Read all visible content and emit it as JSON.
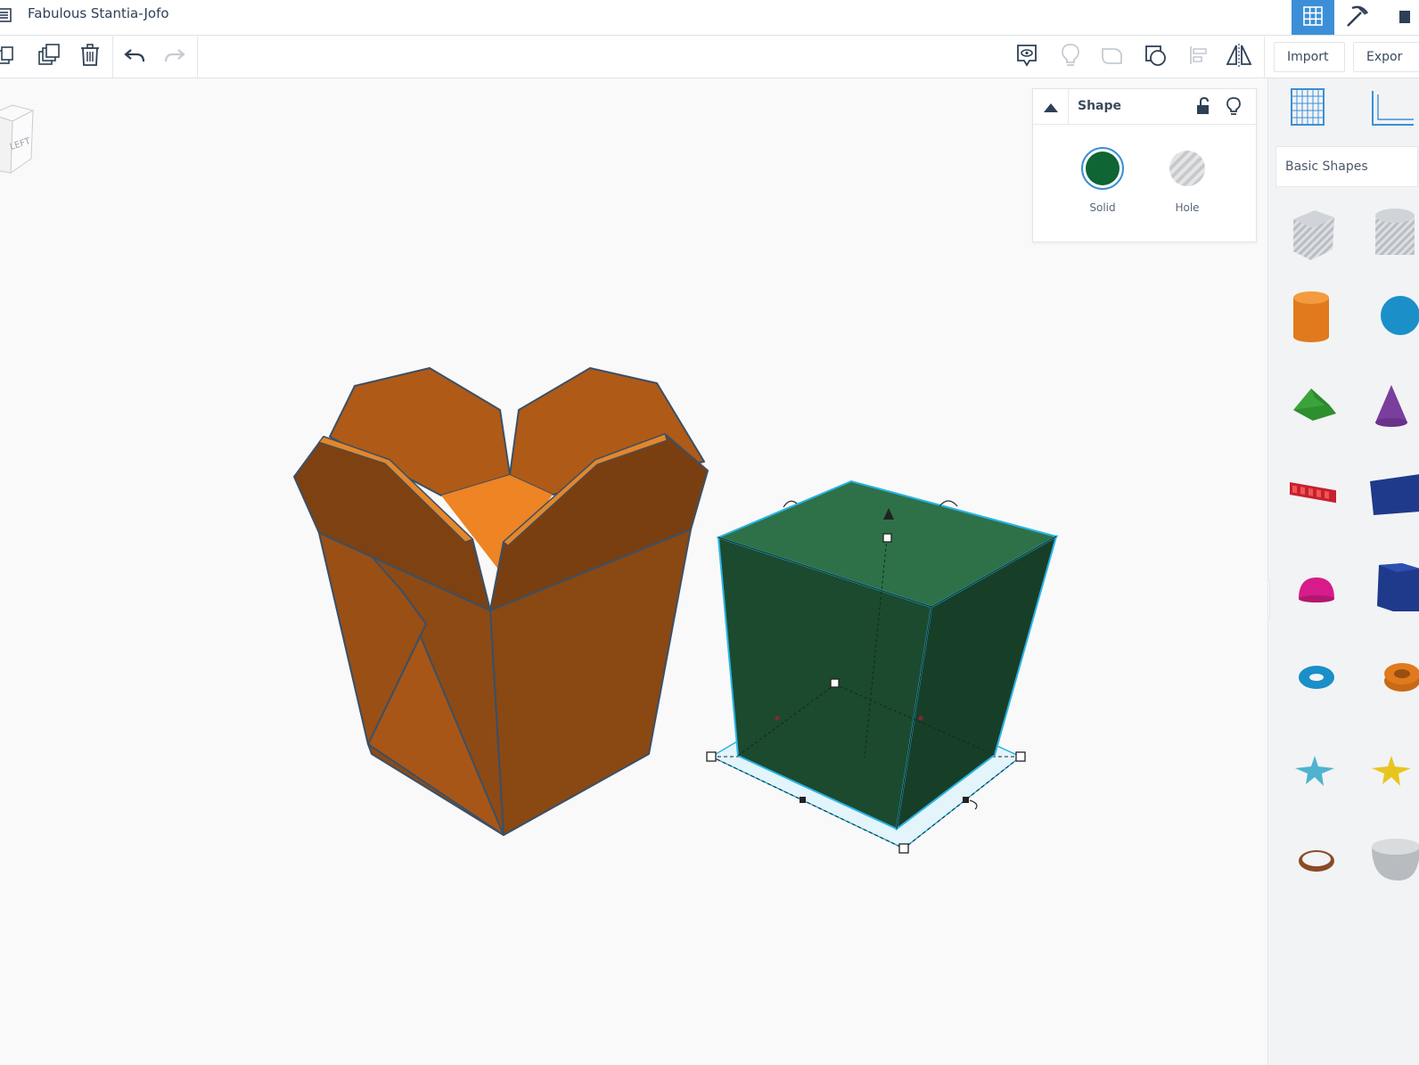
{
  "window": {
    "title": "Fabulous Stantia-Jofo"
  },
  "toolbar": {
    "import_label": "Import",
    "export_label": "Expor"
  },
  "viewcube": {
    "face_label": "LEFT"
  },
  "shape_panel": {
    "title": "Shape",
    "solid_label": "Solid",
    "hole_label": "Hole",
    "solid_color": "#0f6534",
    "selected": "Solid"
  },
  "sidebar": {
    "category": "Basic Shapes",
    "shapes": [
      "box-hole",
      "cylinder-hole",
      "cylinder",
      "sphere",
      "roof",
      "cone",
      "text",
      "wedge",
      "half-sphere",
      "polygon",
      "torus",
      "tube",
      "star",
      "star-yellow",
      "ring",
      "paraboloid"
    ]
  },
  "colors": {
    "accent": "#3c8fd6",
    "orange_box": "#b35a12",
    "green_box": "#1b4a2f",
    "selection": "#28b4e6"
  }
}
